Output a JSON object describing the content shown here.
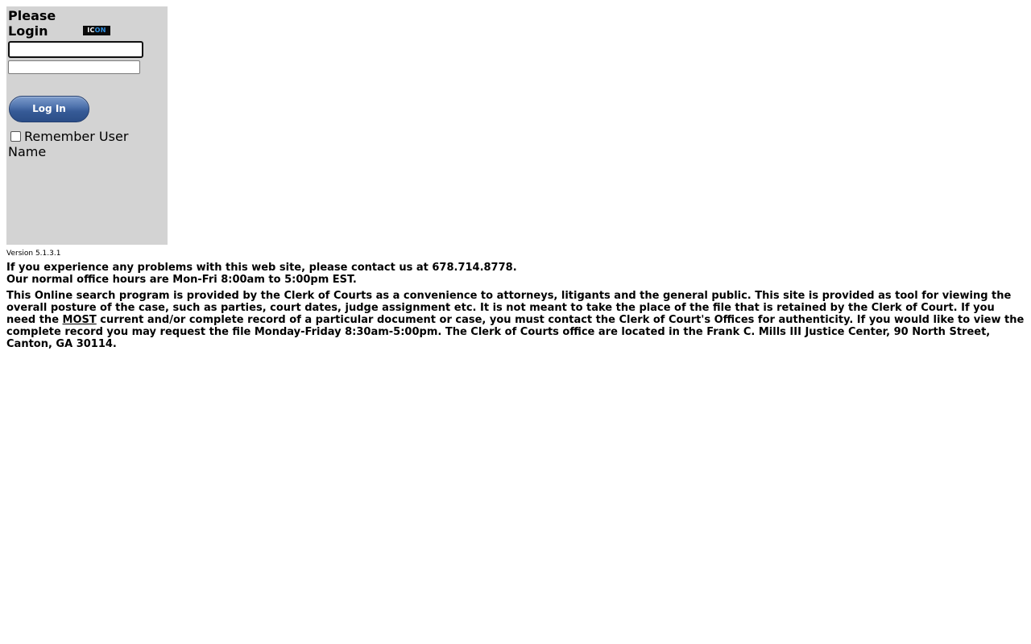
{
  "login": {
    "title": "Please Login",
    "logo": {
      "name": "icon-logo",
      "text_part1": "IC",
      "text_part2": "ON"
    },
    "username": {
      "value": "",
      "placeholder": ""
    },
    "password": {
      "value": "",
      "placeholder": ""
    },
    "button_label": "Log In",
    "remember_label": "Remember User Name",
    "remember_checked": false
  },
  "footer": {
    "version": "Version 5.1.3.1",
    "contact_line1": "If you experience any problems with this web site, please contact us at 678.714.8778.",
    "contact_line2": "Our normal office hours are Mon-Fri 8:00am to 5:00pm EST.",
    "disclaimer_part1": "This Online search program is provided by the Clerk of Courts as a convenience to attorneys, litigants and the general public. This site is provided as tool for viewing the overall posture of the case, such as parties, court dates, judge assignment etc. It is not meant to take the place of the file that is retained by the Clerk of Court. If you need the ",
    "disclaimer_emphasis": "MOST",
    "disclaimer_part2": " current and/or complete record of a particular document or case, you must contact the Clerk of Court's Offices for authenticity. If you would like to view the complete record you may request the file Monday-Friday 8:30am-5:00pm. The Clerk of Courts office are located in the Frank C. Mills III Justice Center, 90 North Street, Canton, GA 30114."
  },
  "colors": {
    "panel_background": "#d3d3d3",
    "button_blue": "#365a96",
    "logo_accent": "#2f8fe0"
  }
}
